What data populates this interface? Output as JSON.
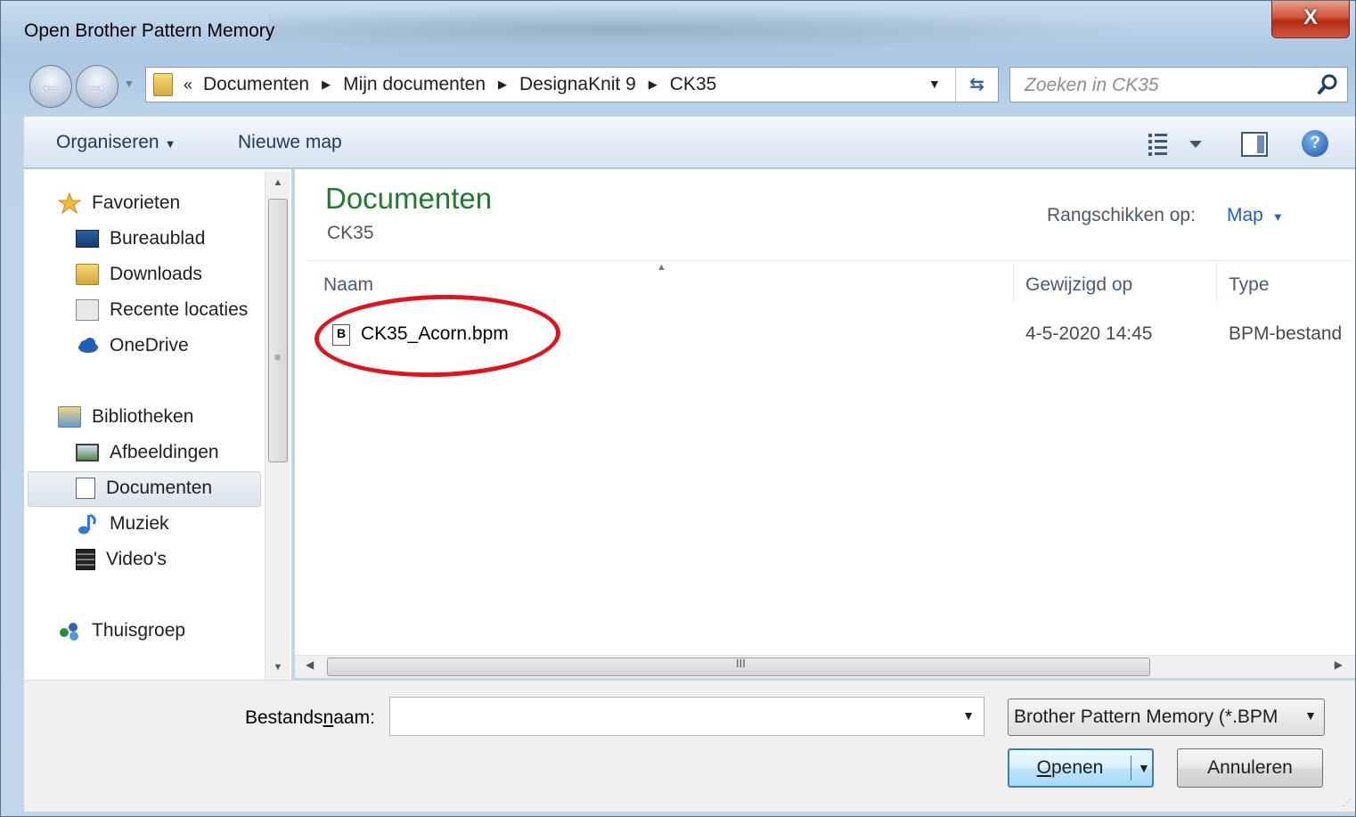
{
  "window": {
    "title": "Open Brother Pattern Memory",
    "close_label": "X"
  },
  "nav": {
    "back_icon": "back-arrow-icon",
    "forward_icon": "forward-arrow-icon",
    "overflow": "«",
    "breadcrumbs": [
      "Documenten",
      "Mijn documenten",
      "DesignaKnit 9",
      "CK35"
    ],
    "search_placeholder": "Zoeken in CK35"
  },
  "toolbar": {
    "organise_label": "Organiseren",
    "new_folder_label": "Nieuwe map"
  },
  "sidebar": {
    "favorites_label": "Favorieten",
    "favorites": [
      "Bureaublad",
      "Downloads",
      "Recente locaties",
      "OneDrive"
    ],
    "libraries_label": "Bibliotheken",
    "libraries": [
      "Afbeeldingen",
      "Documenten",
      "Muziek",
      "Video's"
    ],
    "selected": "Documenten",
    "homegroup_label": "Thuisgroep"
  },
  "library": {
    "title": "Documenten",
    "subtitle": "CK35",
    "arrange_label": "Rangschikken op:",
    "arrange_value": "Map"
  },
  "columns": {
    "name": "Naam",
    "modified": "Gewijzigd op",
    "type": "Type"
  },
  "files": [
    {
      "name": "CK35_Acorn.bpm",
      "modified": "4-5-2020 14:45",
      "type": "BPM-bestand"
    }
  ],
  "footer": {
    "filename_label_pre": "Bestands",
    "filename_label_u": "n",
    "filename_label_post": "aam:",
    "filename_value": "",
    "filetype_value": "Brother Pattern Memory (*.BPM",
    "open_label_u": "O",
    "open_label_rest": "penen",
    "cancel_label": "Annuleren"
  },
  "scroll": {
    "grip": "≡",
    "hgrip": "III"
  },
  "colors": {
    "accent_green": "#1e7a2e",
    "link_blue": "#2062b8",
    "highlight_red": "#e0141c"
  }
}
